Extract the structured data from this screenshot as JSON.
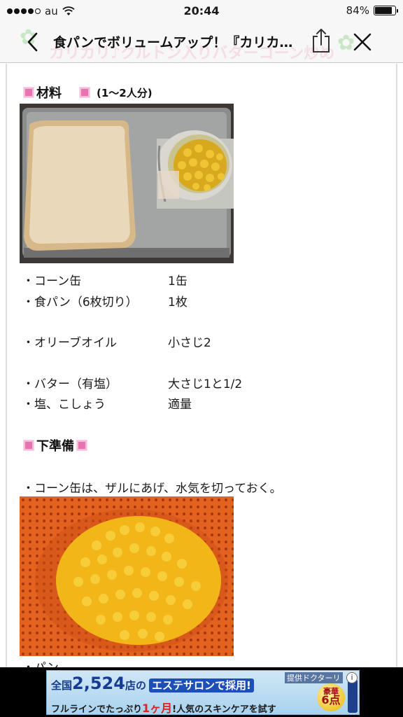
{
  "status_bar": {
    "carrier": "au",
    "time": "20:44",
    "battery_percent": "84%",
    "battery_level": 0.84,
    "signal_bars_filled": 4,
    "signal_bars_total": 5
  },
  "nav": {
    "title": "食パンでボリュームアップ！『カリカ…",
    "background_title": "カリカリ♪クルトン入りバターコーン炒め",
    "back_icon": "chevron-left-icon",
    "share_icon": "share-icon",
    "close_icon": "close-icon"
  },
  "ingredients_section": {
    "heading": "材料",
    "servings": "(1〜2人分)",
    "photo_icon": "bread-and-corn-can-photo",
    "items": [
      {
        "name": "・コーン缶",
        "qty": "1缶"
      },
      {
        "name": "・食パン（6枚切り）",
        "qty": "1枚"
      },
      {
        "name": "・オリーブオイル",
        "qty": "小さじ2"
      },
      {
        "name": "・バター（有塩）",
        "qty": "大さじ1と1/2"
      },
      {
        "name": "・塩、こしょう",
        "qty": "適量"
      }
    ]
  },
  "prep_section": {
    "heading": "下準備",
    "step_1": "・コーン缶は、ザルにあげ、水気を切っておく。",
    "photo_icon": "corn-in-colander-photo",
    "next_step_partial": "・パン…"
  },
  "ad": {
    "line1_prefix": "全国",
    "line1_number": "2,524",
    "line1_middle": "店の",
    "line1_button": "エステサロンで採用!",
    "line2_a": "フルラインでたっぷり",
    "line2_red": "1ヶ月",
    "line2_b": "!人気のスキンケアを試す",
    "provider": "提供ドクターリ",
    "badge_top": "豪華",
    "badge_num": "6点",
    "info_icon": "info-icon",
    "colors": {
      "banner": "#a9d2ee",
      "accent": "#163b93"
    }
  },
  "colors": {
    "pink_marker": "#e973b0",
    "nav_background": "#f7f7f7"
  }
}
